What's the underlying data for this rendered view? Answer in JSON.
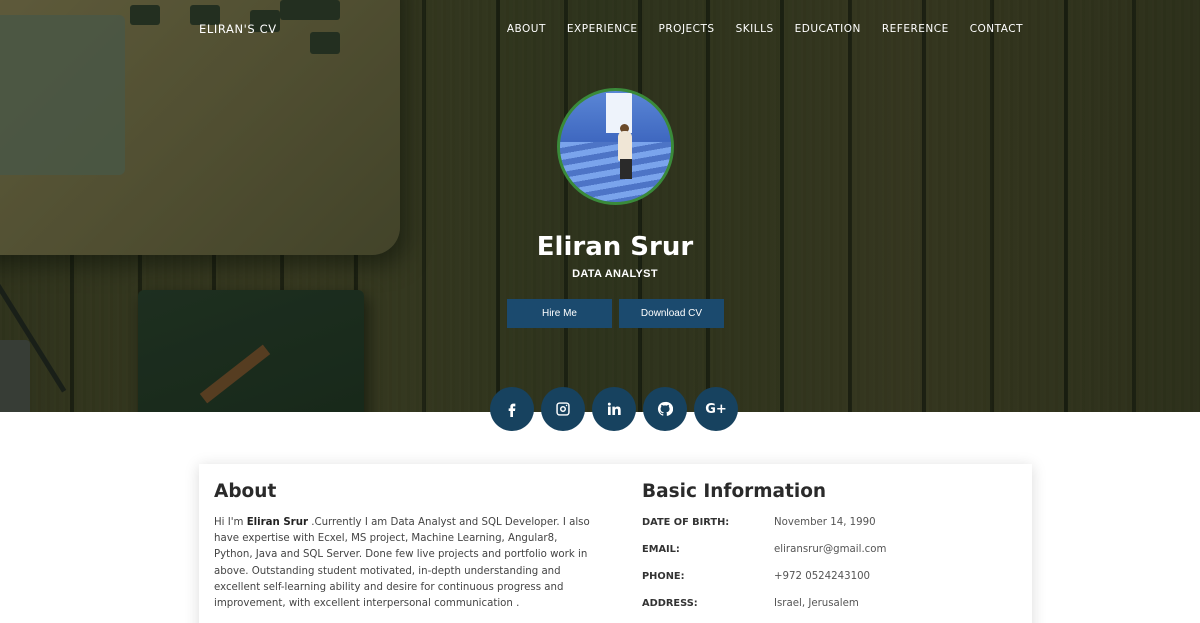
{
  "brand": "ELIRAN'S CV",
  "nav": [
    "ABOUT",
    "EXPERIENCE",
    "PROJECTS",
    "SKILLS",
    "EDUCATION",
    "REFERENCE",
    "CONTACT"
  ],
  "profile": {
    "name": "Eliran Srur",
    "title": "DATA ANALYST",
    "buttons": {
      "hire": "Hire Me",
      "download": "Download CV"
    }
  },
  "social": [
    {
      "icon": "facebook-icon"
    },
    {
      "icon": "instagram-icon"
    },
    {
      "icon": "linkedin-icon"
    },
    {
      "icon": "github-icon"
    },
    {
      "icon": "google-plus-icon",
      "glyph": "G+"
    }
  ],
  "about": {
    "title": "About",
    "intro": "Hi I'm ",
    "name": "Eliran Srur",
    "text": " .Currently I am Data Analyst and SQL Developer. I also have expertise with Ecxel, MS project, Machine Learning, Angular8, Python, Java and SQL Server. Done few live projects and portfolio work in above. Outstanding student motivated, in-depth understanding and excellent self-learning ability and desire for continuous progress and improvement, with excellent interpersonal communication ."
  },
  "basic_info": {
    "title": "Basic Information",
    "rows": [
      {
        "label": "DATE OF BIRTH:",
        "value": "November 14, 1990"
      },
      {
        "label": "EMAIL:",
        "value": "eliransrur@gmail.com"
      },
      {
        "label": "PHONE:",
        "value": "+972 0524243100"
      },
      {
        "label": "ADDRESS:",
        "value": "Israel, Jerusalem"
      }
    ]
  },
  "colors": {
    "button": "#1b4a6e",
    "social": "#17425f",
    "avatar_border": "#3a8a3a"
  }
}
